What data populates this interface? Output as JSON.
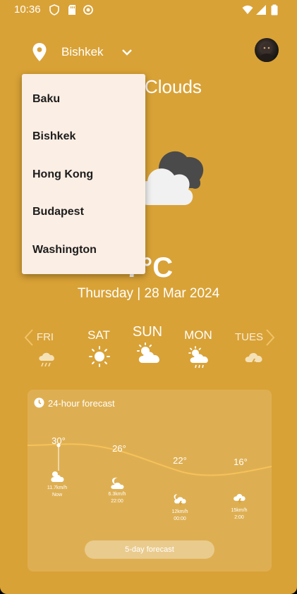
{
  "status_bar": {
    "time": "10:36"
  },
  "header": {
    "city": "Bishkek"
  },
  "weather": {
    "condition": "Clouds",
    "temperature": "7°C",
    "date": "Thursday | 28 Mar 2024"
  },
  "days": [
    {
      "label": "FRI",
      "icon": "rain-cloud-icon"
    },
    {
      "label": "SAT",
      "icon": "sun-icon"
    },
    {
      "label": "SUN",
      "icon": "sun-cloud-icon"
    },
    {
      "label": "MON",
      "icon": "sun-rain-cloud-icon"
    },
    {
      "label": "TUES",
      "icon": "storm-cloud-icon"
    }
  ],
  "forecast": {
    "title": "24-hour forecast",
    "button_label": "5-day forecast",
    "hours": [
      {
        "temp": "30°",
        "wind": "11.7km/h",
        "time": "Now",
        "icon": "sun-cloud-icon"
      },
      {
        "temp": "26°",
        "wind": "6.3km/h",
        "time": "22:00",
        "icon": "moon-cloud-icon"
      },
      {
        "temp": "22°",
        "wind": "12km/h",
        "time": "00:00",
        "icon": "night-storm-icon"
      },
      {
        "temp": "16°",
        "wind": "15km/h",
        "time": "2:00",
        "icon": "storm-cloud-icon"
      }
    ]
  },
  "dropdown": {
    "options": [
      "Baku",
      "Bishkek",
      "Hong Kong",
      "Budapest",
      "Washington"
    ]
  },
  "colors": {
    "background": "#d9a236",
    "dropdown_bg": "#fbeee4",
    "curve": "#f6c25a"
  }
}
